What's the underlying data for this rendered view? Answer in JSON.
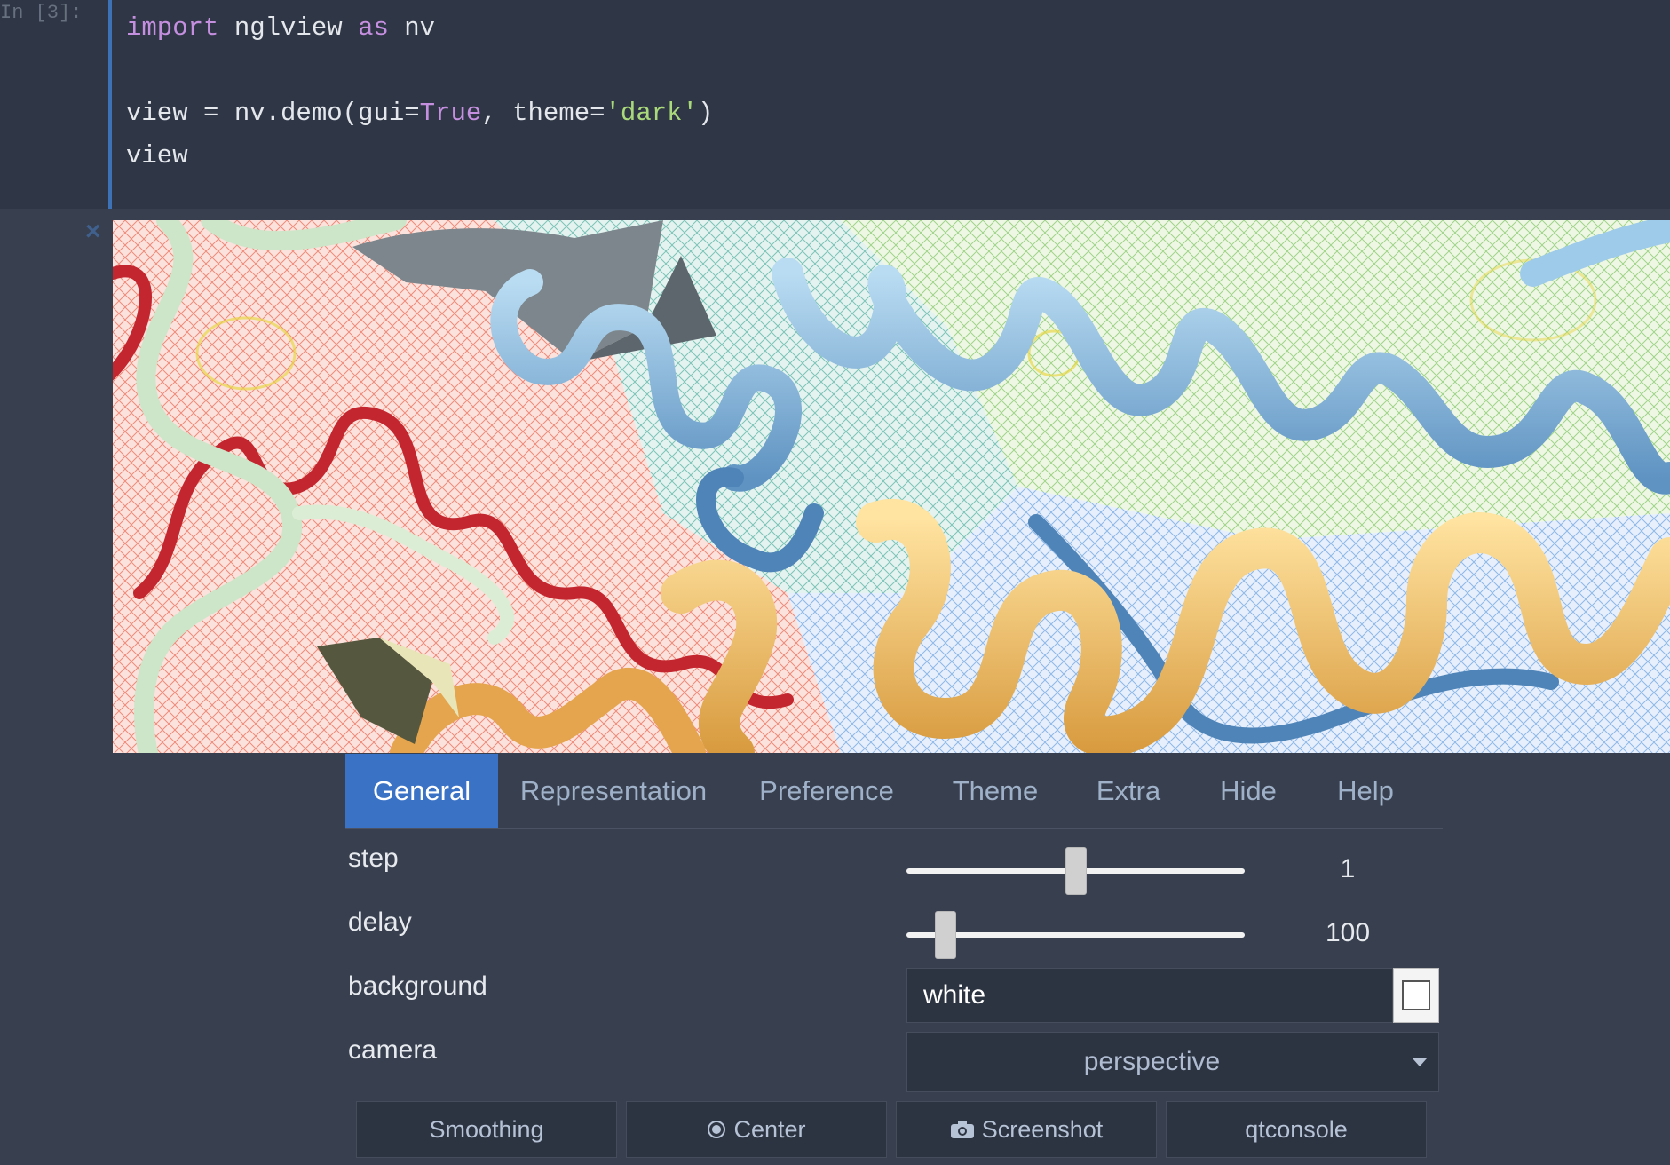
{
  "cell": {
    "prompt": "In [3]:",
    "lines": [
      [
        "import",
        " nglview ",
        "as",
        " nv"
      ],
      [
        ""
      ],
      [
        "view = nv.demo(gui=",
        "True",
        ", theme=",
        "'dark'",
        ")"
      ],
      [
        "view"
      ]
    ]
  },
  "output": {
    "close_symbol": "×"
  },
  "tabs": [
    {
      "label": "General",
      "active": true
    },
    {
      "label": "Representation",
      "active": false
    },
    {
      "label": "Preference",
      "active": false
    },
    {
      "label": "Theme",
      "active": false
    },
    {
      "label": "Extra",
      "active": false
    },
    {
      "label": "Hide",
      "active": false
    },
    {
      "label": "Help",
      "active": false
    }
  ],
  "general": {
    "step": {
      "label": "step",
      "value": "1",
      "slider_fraction": 0.5
    },
    "delay": {
      "label": "delay",
      "value": "100",
      "slider_fraction": 0.115
    },
    "background": {
      "label": "background",
      "value": "white",
      "swatch_color": "#ffffff"
    },
    "camera": {
      "label": "camera",
      "value": "perspective"
    }
  },
  "buttons": {
    "smoothing": "Smoothing",
    "center": "Center",
    "screenshot": "Screenshot",
    "qtconsole": "qtconsole"
  },
  "colors": {
    "accent": "#3a72c5",
    "code_bg": "#2f3645",
    "panel_bg": "#383f4e"
  }
}
